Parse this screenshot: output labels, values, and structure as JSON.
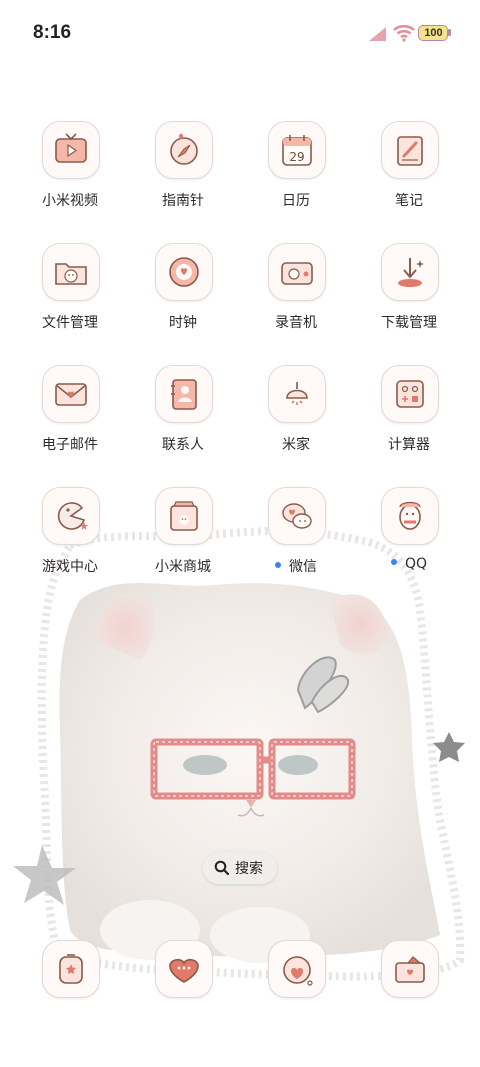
{
  "status_bar": {
    "time": "8:16",
    "battery": "100"
  },
  "apps": [
    {
      "label": "小米视频",
      "icon": "video-player-icon"
    },
    {
      "label": "指南针",
      "icon": "compass-icon"
    },
    {
      "label": "日历",
      "icon": "calendar-icon",
      "date": "29"
    },
    {
      "label": "笔记",
      "icon": "notes-icon"
    },
    {
      "label": "文件管理",
      "icon": "folder-icon"
    },
    {
      "label": "时钟",
      "icon": "clock-icon"
    },
    {
      "label": "录音机",
      "icon": "recorder-icon"
    },
    {
      "label": "下载管理",
      "icon": "download-icon"
    },
    {
      "label": "电子邮件",
      "icon": "mail-icon"
    },
    {
      "label": "联系人",
      "icon": "contacts-icon"
    },
    {
      "label": "米家",
      "icon": "smart-home-icon"
    },
    {
      "label": "计算器",
      "icon": "calculator-icon"
    },
    {
      "label": "游戏中心",
      "icon": "game-center-icon"
    },
    {
      "label": "小米商城",
      "icon": "mi-store-icon"
    },
    {
      "label": "微信",
      "icon": "wechat-icon",
      "badge": true
    },
    {
      "label": "QQ",
      "icon": "qq-icon",
      "badge": true
    }
  ],
  "search": {
    "label": "搜索"
  },
  "dock": [
    {
      "icon": "phone-icon"
    },
    {
      "icon": "messages-icon"
    },
    {
      "icon": "browser-icon"
    },
    {
      "icon": "camera-icon"
    }
  ],
  "colors": {
    "icon_accent": "#e07a6a",
    "icon_outline": "#8a5a4a",
    "notification_dot": "#3b82f6",
    "battery_fill": "#f6e28a"
  }
}
